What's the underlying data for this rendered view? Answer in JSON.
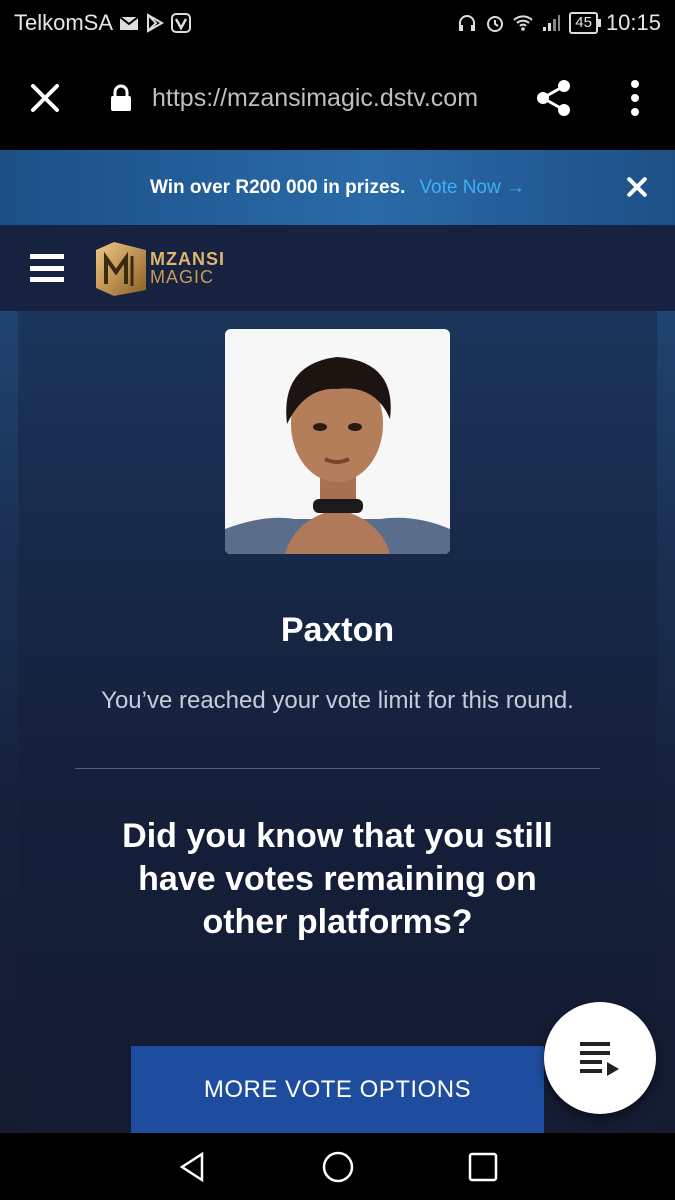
{
  "status_bar": {
    "carrier": "TelkomSA",
    "battery": "45",
    "time": "10:15"
  },
  "browser": {
    "url": "https://mzansimagic.dstv.com"
  },
  "promo": {
    "text": "Win over R200 000 in prizes.",
    "link_label": "Vote Now →"
  },
  "header": {
    "logo_line1": "MZANSI",
    "logo_line2": "MAGIC"
  },
  "main": {
    "contestant_name": "Paxton",
    "limit_message": "You’ve reached your vote limit for this round.",
    "question": "Did you know that you still have votes remaining on other platforms?",
    "more_options_label": "MORE VOTE OPTIONS"
  },
  "colors": {
    "promo_link": "#3fb0f5",
    "button_blue": "#1e4da0",
    "header_bg": "#16223f",
    "logo_gold": "#e0b56a"
  }
}
